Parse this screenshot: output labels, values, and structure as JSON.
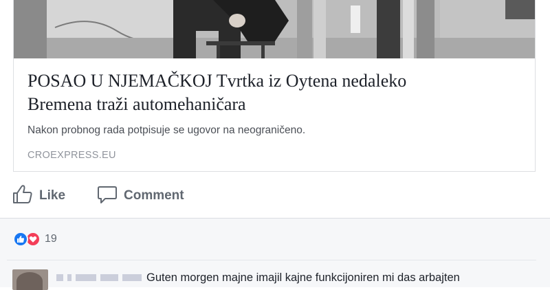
{
  "link_preview": {
    "title": "POSAO U NJEMAČKOJ Tvrtka iz Oytena nedaleko\nBremena traži automehaničara",
    "description": "Nakon probnog rada potpisuje se ugovor na neograničeno.",
    "domain": "CROEXPRESS.EU"
  },
  "actions": {
    "like_label": "Like",
    "like_icon": "thumbs-up-icon",
    "comment_label": "Comment",
    "comment_icon": "speech-bubble-icon"
  },
  "reactions": {
    "types": [
      "like",
      "love"
    ],
    "count": "19",
    "colors": {
      "like": "#1877f2",
      "love": "#f33e58"
    }
  },
  "comment": {
    "text": "Guten morgen majne imajil kajne funkcijoniren mi das arbajten"
  }
}
